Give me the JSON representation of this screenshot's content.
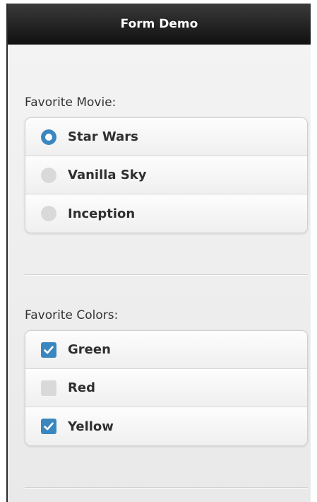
{
  "header": {
    "title": "Form Demo"
  },
  "movie_field": {
    "label": "Favorite Movie:",
    "options": [
      {
        "label": "Star Wars",
        "selected": true
      },
      {
        "label": "Vanilla Sky",
        "selected": false
      },
      {
        "label": "Inception",
        "selected": false
      }
    ]
  },
  "color_field": {
    "label": "Favorite Colors:",
    "options": [
      {
        "label": "Green",
        "checked": true
      },
      {
        "label": "Red",
        "checked": false
      },
      {
        "label": "Yellow",
        "checked": true
      }
    ]
  },
  "colors": {
    "accent": "#3a87c0",
    "header_bg": "#1c1c1c",
    "page_bg": "#f0f0f0"
  }
}
